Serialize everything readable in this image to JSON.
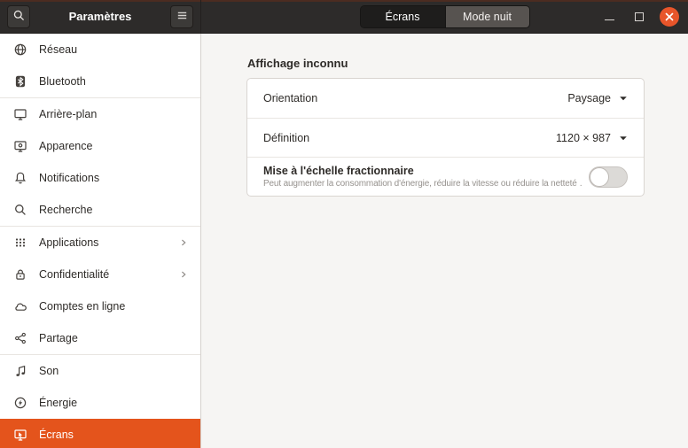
{
  "window": {
    "title": "Paramètres",
    "header_tabs": [
      {
        "label": "Écrans",
        "active": true
      },
      {
        "label": "Mode nuit",
        "active": false
      }
    ]
  },
  "sidebar": {
    "items": [
      {
        "name": "reseau",
        "label": "Réseau",
        "icon": "network-globe-icon"
      },
      {
        "name": "bluetooth",
        "label": "Bluetooth",
        "icon": "bluetooth-icon"
      },
      {
        "name": "arriere-plan",
        "label": "Arrière-plan",
        "icon": "background-monitor-icon",
        "group_start": true
      },
      {
        "name": "apparence",
        "label": "Apparence",
        "icon": "appearance-monitor-icon"
      },
      {
        "name": "notifications",
        "label": "Notifications",
        "icon": "bell-icon"
      },
      {
        "name": "recherche",
        "label": "Recherche",
        "icon": "search-icon"
      },
      {
        "name": "applications",
        "label": "Applications",
        "icon": "apps-grid-icon",
        "chevron": true,
        "group_start": true
      },
      {
        "name": "confidentialite",
        "label": "Confidentialité",
        "icon": "lock-icon",
        "chevron": true
      },
      {
        "name": "comptes-en-ligne",
        "label": "Comptes en ligne",
        "icon": "cloud-icon"
      },
      {
        "name": "partage",
        "label": "Partage",
        "icon": "share-icon"
      },
      {
        "name": "son",
        "label": "Son",
        "icon": "music-note-icon",
        "group_start": true
      },
      {
        "name": "energie",
        "label": "Énergie",
        "icon": "power-icon"
      },
      {
        "name": "ecrans",
        "label": "Écrans",
        "icon": "displays-icon",
        "selected": true
      }
    ]
  },
  "main": {
    "heading": "Affichage inconnu",
    "rows": [
      {
        "name": "orientation",
        "label": "Orientation",
        "value": "Paysage",
        "control": "dropdown"
      },
      {
        "name": "definition",
        "label": "Définition",
        "value": "1120 × 987",
        "control": "dropdown"
      },
      {
        "name": "fractional-scaling",
        "label": "Mise à l'échelle fractionnaire",
        "subtitle": "Peut augmenter la consommation d'énergie, réduire la vitesse ou réduire la netteté …",
        "control": "toggle",
        "toggle_on": false
      }
    ]
  },
  "colors": {
    "accent_orange": "#E4541C",
    "close_button_orange": "#E8552A",
    "header_background": "#2d2b2a",
    "header_tab_active": "#1e1d1c",
    "header_tab_inactive": "#575350",
    "sidebar_background": "#ffffff",
    "content_background": "#f6f5f3",
    "panel_border": "#d9d5d1",
    "toggle_track": "#dcdad7",
    "text_dark": "#2e2b28",
    "text_muted": "#96928e"
  }
}
